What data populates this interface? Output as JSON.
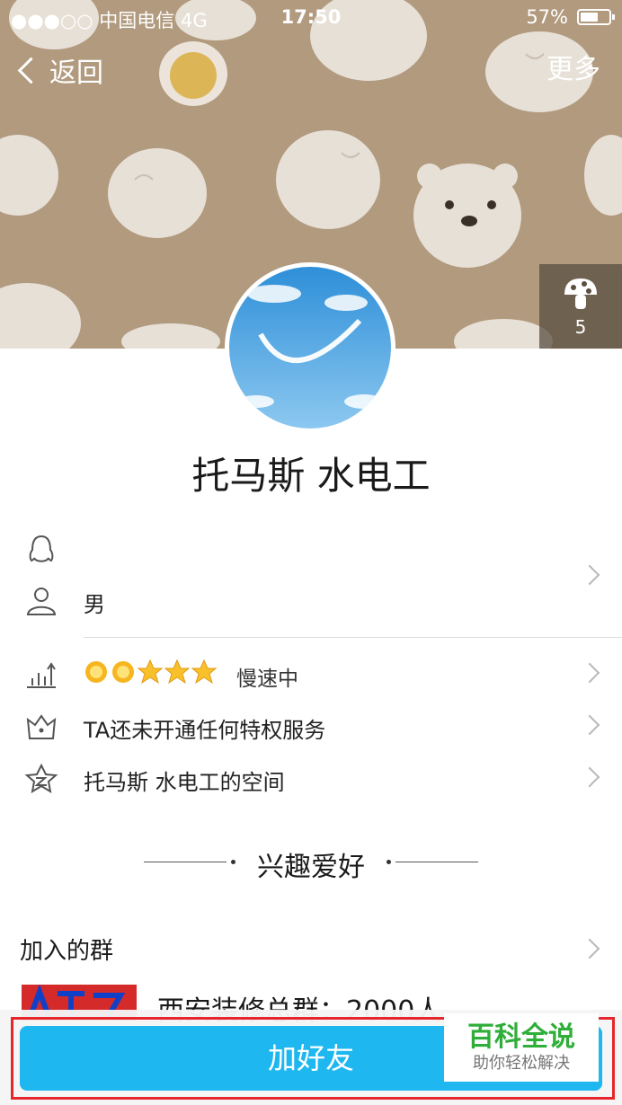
{
  "status_bar": {
    "carrier": "●●●○○ 中国电信  4G",
    "time": "17:50",
    "battery": "57%"
  },
  "nav": {
    "back_label": "返回",
    "more_label": "更多"
  },
  "likes": {
    "count": "5"
  },
  "profile": {
    "name": "托马斯  水电工",
    "gender": "男"
  },
  "info_rows": {
    "level_text": "慢速中",
    "privilege": "TA还未开通任何特权服务",
    "space": "托马斯  水电工的空间"
  },
  "interests": {
    "title": "兴趣爱好"
  },
  "groups": {
    "title": "加入的群",
    "first_group_name": "西安装修总群：2000人"
  },
  "actions": {
    "add_friend": "加好友"
  },
  "watermark": {
    "line1": "百科全说",
    "line2": "助你轻松解决"
  },
  "colors": {
    "header_bg": "#b19a7e",
    "accent": "#1fb7ef",
    "highlight": "#e5262b"
  },
  "icons": [
    "qq-penguin-icon",
    "person-icon",
    "level-chart-icon",
    "crown-icon",
    "star-space-icon",
    "mushroom-like-icon",
    "sun-level-icon",
    "star-level-icon"
  ]
}
